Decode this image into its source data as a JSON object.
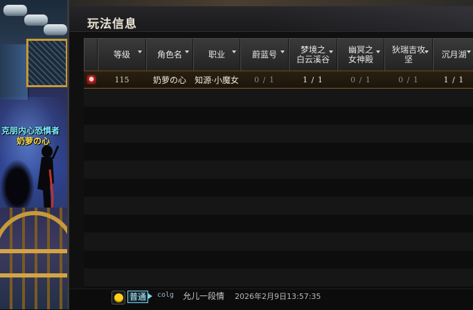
{
  "window": {
    "title": "玩法信息"
  },
  "scene": {
    "overhead_name": "克朋内心恐惧者",
    "character_name": "奶萝の心"
  },
  "table": {
    "columns": [
      {
        "label": "等级",
        "sortable": true
      },
      {
        "label": "角色名",
        "sortable": true
      },
      {
        "label": "职业",
        "sortable": true
      },
      {
        "label": "蔚蓝号",
        "sortable": true
      },
      {
        "label": "梦境之\n白云溪谷",
        "sortable": true
      },
      {
        "label": "幽冥之\n女神殿",
        "sortable": true
      },
      {
        "label": "狄瑞吉攻\n坚",
        "sortable": true
      },
      {
        "label": "沉月湖",
        "sortable": true
      }
    ],
    "rows": [
      {
        "level": "115",
        "name": "奶萝の心",
        "job": "知源·小魔女",
        "c1": "0 / 1",
        "c2": "1 / 1",
        "c3": "0 / 1",
        "c4": "0 / 1",
        "c5": "1 / 1",
        "selected": true
      }
    ],
    "empty_row_count": 12
  },
  "chat": {
    "channel": "普通",
    "sender": "colg",
    "message": "允儿一段情",
    "timestamp": "2026年2月9日13:57:35"
  }
}
